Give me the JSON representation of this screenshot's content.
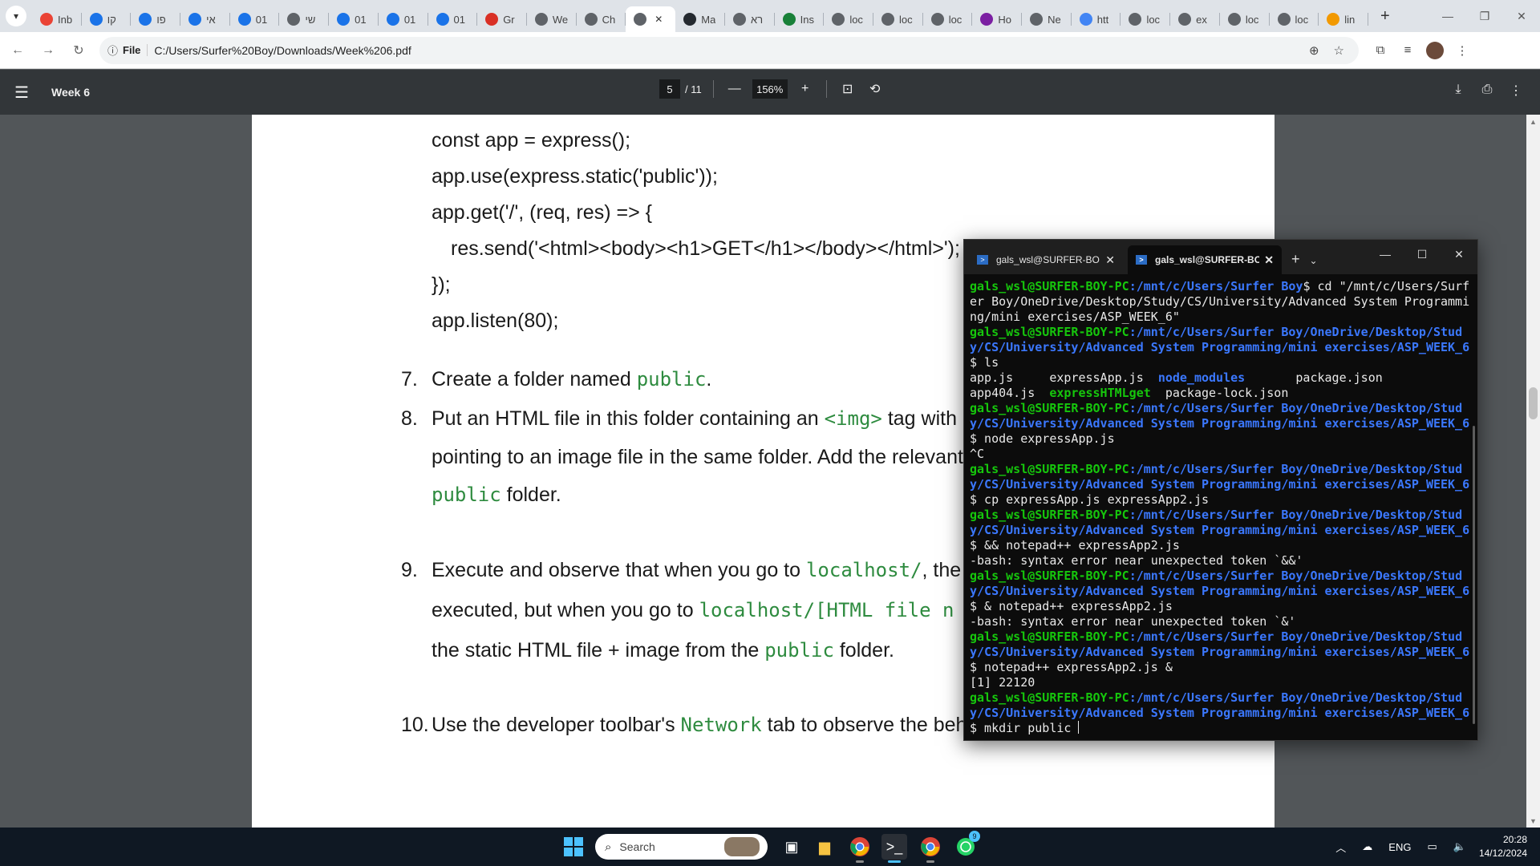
{
  "browser": {
    "tabs": [
      {
        "label": "Inb",
        "favicon": "gmail-icon",
        "color": "#ea4335"
      },
      {
        "label": "קו",
        "favicon": "moodle-icon",
        "color": "#1a73e8"
      },
      {
        "label": "פו",
        "favicon": "moodle-icon",
        "color": "#1a73e8"
      },
      {
        "label": "אי",
        "favicon": "moodle-icon",
        "color": "#1a73e8"
      },
      {
        "label": "01",
        "favicon": "moodle-icon",
        "color": "#1a73e8"
      },
      {
        "label": "שי",
        "favicon": "globe-icon",
        "color": "#5f6368"
      },
      {
        "label": "01",
        "favicon": "moodle-icon",
        "color": "#1a73e8"
      },
      {
        "label": "01",
        "favicon": "moodle-icon",
        "color": "#1a73e8"
      },
      {
        "label": "01",
        "favicon": "moodle-icon",
        "color": "#1a73e8"
      },
      {
        "label": "Gr",
        "favicon": "sy-icon",
        "color": "#d93025"
      },
      {
        "label": "We",
        "favicon": "globe-icon",
        "color": "#5f6368"
      },
      {
        "label": "Ch",
        "favicon": "chatgpt-icon",
        "color": "#5f6368"
      },
      {
        "label": "",
        "favicon": "globe-icon",
        "color": "#5f6368",
        "active": true
      },
      {
        "label": "Ma",
        "favicon": "github-icon",
        "color": "#24292f"
      },
      {
        "label": "רא",
        "favicon": "globe-icon",
        "color": "#5f6368"
      },
      {
        "label": "Ins",
        "favicon": "link-icon",
        "color": "#188038"
      },
      {
        "label": "loc",
        "favicon": "globe-icon",
        "color": "#5f6368"
      },
      {
        "label": "loc",
        "favicon": "globe-icon",
        "color": "#5f6368"
      },
      {
        "label": "loc",
        "favicon": "globe-icon",
        "color": "#5f6368"
      },
      {
        "label": "Ho",
        "favicon": "info-icon",
        "color": "#7b1fa2"
      },
      {
        "label": "Ne",
        "favicon": "globe-icon",
        "color": "#5f6368"
      },
      {
        "label": "htt",
        "favicon": "google-icon",
        "color": "#4285f4"
      },
      {
        "label": "loc",
        "favicon": "globe-icon",
        "color": "#5f6368"
      },
      {
        "label": "ex",
        "favicon": "globe-icon",
        "color": "#5f6368"
      },
      {
        "label": "loc",
        "favicon": "globe-icon",
        "color": "#5f6368"
      },
      {
        "label": "loc",
        "favicon": "globe-icon",
        "color": "#5f6368"
      },
      {
        "label": "lin",
        "favicon": "flame-icon",
        "color": "#f29900"
      }
    ],
    "address": {
      "scheme_label": "File",
      "url": "C:/Users/Surfer%20Boy/Downloads/Week%206.pdf"
    }
  },
  "pdf": {
    "title": "Week 6",
    "page_current": "5",
    "page_total": "/ 11",
    "zoom": "156%",
    "code_lines": [
      "const app = express();",
      "app.use(express.static('public'));",
      "app.get('/', (req, res) => {",
      "res.send('<html><body><h1>GET</h1></body></html>');",
      "});",
      "app.listen(80);"
    ],
    "steps": {
      "s7": {
        "num": "7.",
        "a": "Create a folder named ",
        "code": "public",
        "b": "."
      },
      "s8": {
        "num": "8.",
        "a": "Put an HTML file in this folder containing an ",
        "code": "<img>",
        "b": " tag with",
        "line2": "pointing to an image file in the same folder. Add the relevant",
        "code3": "public",
        "b3": " folder."
      },
      "s9": {
        "num": "9.",
        "a": "Execute and observe that when you go to ",
        "code": "localhost/",
        "b": ", the",
        "line2a": "executed, but when you go to ",
        "code2": "localhost/[HTML file n",
        "line3a": "the static HTML file + image from the ",
        "code3": "public",
        "b3": " folder."
      },
      "s10": {
        "num": "10.",
        "a": "Use the developer toolbar's ",
        "code": "Network",
        "b": " tab to observe the beh"
      }
    }
  },
  "terminal": {
    "tabs": [
      {
        "label": "gals_wsl@SURFER-BO",
        "active": false
      },
      {
        "label": "gals_wsl@SURFER-BC",
        "active": true
      }
    ],
    "lines": [
      {
        "user": "gals_wsl@SURFER-BOY-PC",
        "path": ":/mnt/c/Users/Surfer Boy",
        "cmd": "$ cd \"/mnt/c/Users/Surfer Boy/OneDrive/Desktop/Study/CS/University/Advanced System Programming/mini exercises/ASP_WEEK_6\""
      },
      {
        "user": "gals_wsl@SURFER-BOY-PC",
        "path": ":/mnt/c/Users/Surfer Boy/OneDrive/Desktop/Study/CS/University/Advanced System Programming/mini exercises/ASP_WEEK_6",
        "cmd": "$ ls"
      },
      {
        "ls": [
          [
            "app.js",
            "w"
          ],
          [
            "     ",
            "w"
          ],
          [
            "expressApp.js",
            "w"
          ],
          [
            "  ",
            "w"
          ],
          [
            "node_modules",
            "b"
          ],
          [
            "       ",
            "w"
          ],
          [
            "package.json",
            "w"
          ]
        ]
      },
      {
        "ls": [
          [
            "app404.js",
            "w"
          ],
          [
            "  ",
            "w"
          ],
          [
            "expressHTMLget",
            "g"
          ],
          [
            "  ",
            "w"
          ],
          [
            "package-lock.json",
            "w"
          ]
        ]
      },
      {
        "user": "gals_wsl@SURFER-BOY-PC",
        "path": ":/mnt/c/Users/Surfer Boy/OneDrive/Desktop/Study/CS/University/Advanced System Programming/mini exercises/ASP_WEEK_6",
        "cmd": "$ node expressApp.js"
      },
      {
        "out": "^C"
      },
      {
        "user": "gals_wsl@SURFER-BOY-PC",
        "path": ":/mnt/c/Users/Surfer Boy/OneDrive/Desktop/Study/CS/University/Advanced System Programming/mini exercises/ASP_WEEK_6",
        "cmd": "$ cp expressApp.js expressApp2.js"
      },
      {
        "user": "gals_wsl@SURFER-BOY-PC",
        "path": ":/mnt/c/Users/Surfer Boy/OneDrive/Desktop/Study/CS/University/Advanced System Programming/mini exercises/ASP_WEEK_6",
        "cmd": "$ && notepad++ expressApp2.js"
      },
      {
        "out": "-bash: syntax error near unexpected token `&&'"
      },
      {
        "user": "gals_wsl@SURFER-BOY-PC",
        "path": ":/mnt/c/Users/Surfer Boy/OneDrive/Desktop/Study/CS/University/Advanced System Programming/mini exercises/ASP_WEEK_6",
        "cmd": "$ & notepad++ expressApp2.js"
      },
      {
        "out": "-bash: syntax error near unexpected token `&'"
      },
      {
        "user": "gals_wsl@SURFER-BOY-PC",
        "path": ":/mnt/c/Users/Surfer Boy/OneDrive/Desktop/Study/CS/University/Advanced System Programming/mini exercises/ASP_WEEK_6",
        "cmd": "$ notepad++ expressApp2.js &"
      },
      {
        "out": "[1] 22120"
      },
      {
        "user": "gals_wsl@SURFER-BOY-PC",
        "path": ":/mnt/c/Users/Surfer Boy/OneDrive/Desktop/Study/CS/University/Advanced System Programming/mini exercises/ASP_WEEK_6",
        "cmd": "$ mkdir public ",
        "cursor": true
      }
    ]
  },
  "taskbar": {
    "search_placeholder": "Search",
    "lang": "ENG",
    "time": "20:28",
    "date": "14/12/2024",
    "whatsapp_badge": "9"
  },
  "colors": {
    "terminal_green": "#16c60c",
    "terminal_blue": "#3b78ff",
    "pdf_code_green": "#2e8b3f",
    "accent": "#4cc2ff"
  }
}
